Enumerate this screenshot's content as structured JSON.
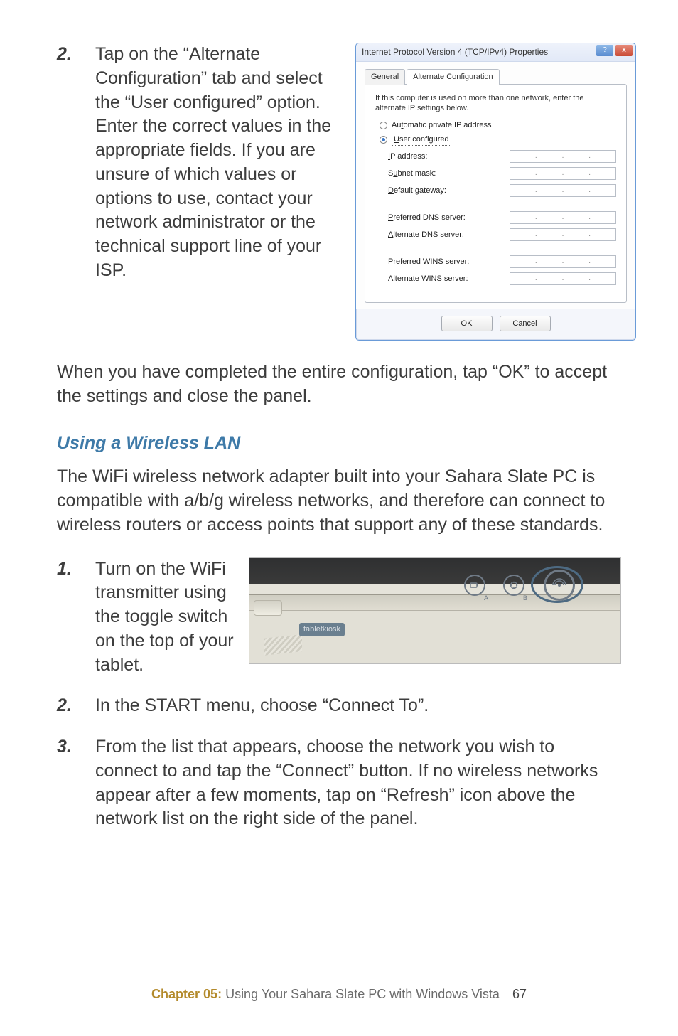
{
  "step2": {
    "num": "2.",
    "text": "Tap on the “Alternate Configuration” tab and select the “User configured” option. Enter the correct values in the appropriate fields. If you are unsure of which values or options to use, contact your network administrator or the technical support line of your ISP."
  },
  "dialog": {
    "title": "Internet Protocol Version 4 (TCP/IPv4) Properties",
    "tabs": {
      "general": "General",
      "alt": "Alternate Configuration"
    },
    "hint": "If this computer is used on more than one network, enter the alternate IP settings below.",
    "radio_auto": {
      "label_pre": "Au",
      "u": "t",
      "label_post": "omatic private IP address"
    },
    "radio_user": {
      "u": "U",
      "label_post": "ser configured"
    },
    "fields": {
      "ip": {
        "u": "I",
        "rest": "P address:"
      },
      "sub": {
        "pre": "S",
        "u": "u",
        "rest": "bnet mask:"
      },
      "gw": {
        "u": "D",
        "rest": "efault gateway:"
      },
      "pdns": {
        "pre": "",
        "u": "P",
        "rest": "referred DNS server:"
      },
      "adns": {
        "u": "A",
        "rest": "lternate DNS server:"
      },
      "pwins": {
        "pre": "Preferred ",
        "u": "W",
        "rest": "INS server:"
      },
      "awins": {
        "pre": "Alternate WI",
        "u": "N",
        "rest": "S server:"
      }
    },
    "ok": "OK",
    "cancel": "Cancel",
    "help_glyph": "?",
    "close_glyph": "x"
  },
  "after_para": "When you have completed the entire configuration, tap “OK” to accept the settings and close the panel.",
  "subhead": "Using a Wireless LAN",
  "wifi_intro": "The WiFi wireless network adapter built into your Sahara Slate PC is compatible with a/b/g wireless networks, and therefore can connect to wireless routers or access points that support any of these standards.",
  "wifi_steps": {
    "s1": {
      "num": "1.",
      "text": "Turn on the WiFi transmitter using the toggle switch on the top of your tablet."
    },
    "s2": {
      "num": "2.",
      "text": "In the START menu, choose “Connect To”."
    },
    "s3": {
      "num": "3.",
      "text": "From the list that appears, choose the network you wish to connect to and tap the “Connect” button. If no wireless networks appear after a few moments, tap on “Refresh” icon above the network list on the right side of the panel."
    }
  },
  "photo": {
    "brand": "tabletkiosk"
  },
  "footer": {
    "chapter": "Chapter 05:",
    "title": " Using Your Sahara Slate PC with Windows Vista",
    "page": "67"
  }
}
